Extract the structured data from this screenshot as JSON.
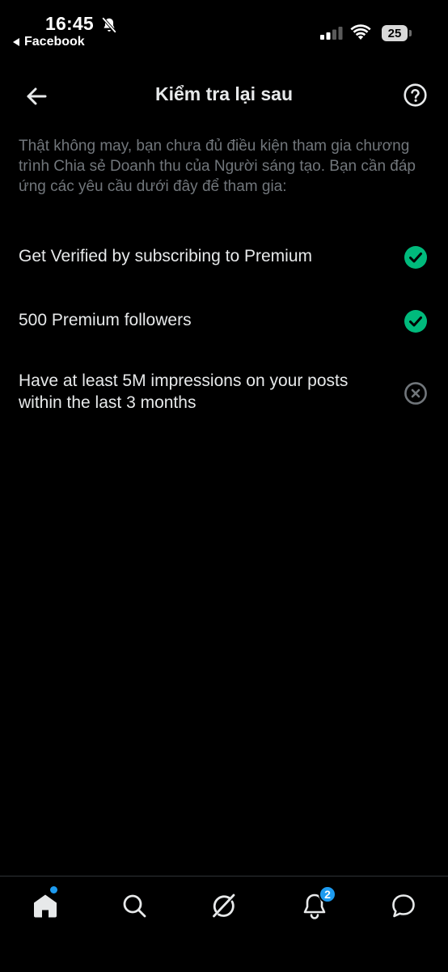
{
  "status_bar": {
    "time": "16:45",
    "back_app": "Facebook",
    "battery": "25"
  },
  "header": {
    "title": "Kiểm tra lại sau"
  },
  "intro": "Thật không may, bạn chưa đủ điều kiện tham gia chương trình Chia sẻ Doanh thu của Người sáng tạo. Bạn cần đáp ứng các yêu cầu dưới đây để tham gia:",
  "requirements": [
    {
      "label": "Get Verified by subscribing to Premium",
      "met": true
    },
    {
      "label": "500 Premium followers",
      "met": true
    },
    {
      "label": "Have at least 5M impressions on your posts within the last 3 months",
      "met": false
    }
  ],
  "tabs": [
    {
      "name": "home",
      "icon": "home-icon"
    },
    {
      "name": "search",
      "icon": "search-icon"
    },
    {
      "name": "grok",
      "icon": "grok-icon"
    },
    {
      "name": "notifications",
      "icon": "bell-icon",
      "badge": "2"
    },
    {
      "name": "messages",
      "icon": "message-icon"
    }
  ],
  "colors": {
    "background": "#000000",
    "text": "#e7e9ea",
    "secondary_text": "#71767b",
    "check_green": "#00ba7c",
    "accent_blue": "#1d9bf0"
  }
}
